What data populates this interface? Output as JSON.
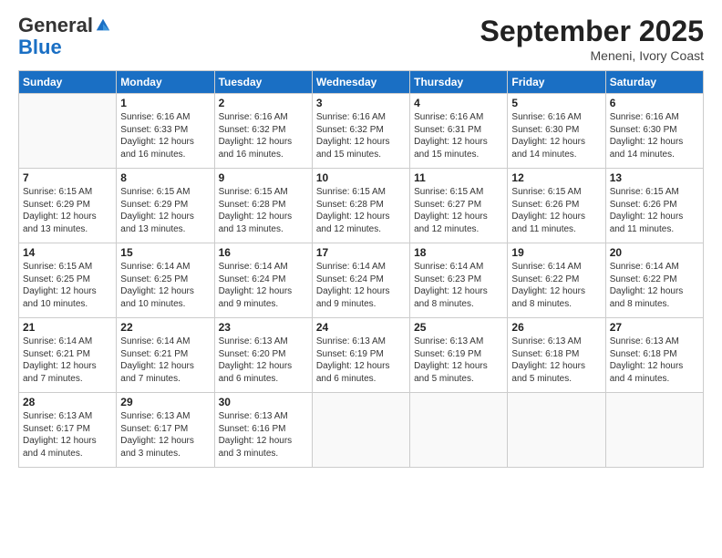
{
  "logo": {
    "general": "General",
    "blue": "Blue"
  },
  "title": "September 2025",
  "location": "Meneni, Ivory Coast",
  "days_header": [
    "Sunday",
    "Monday",
    "Tuesday",
    "Wednesday",
    "Thursday",
    "Friday",
    "Saturday"
  ],
  "weeks": [
    [
      {
        "day": "",
        "info": ""
      },
      {
        "day": "1",
        "info": "Sunrise: 6:16 AM\nSunset: 6:33 PM\nDaylight: 12 hours\nand 16 minutes."
      },
      {
        "day": "2",
        "info": "Sunrise: 6:16 AM\nSunset: 6:32 PM\nDaylight: 12 hours\nand 16 minutes."
      },
      {
        "day": "3",
        "info": "Sunrise: 6:16 AM\nSunset: 6:32 PM\nDaylight: 12 hours\nand 15 minutes."
      },
      {
        "day": "4",
        "info": "Sunrise: 6:16 AM\nSunset: 6:31 PM\nDaylight: 12 hours\nand 15 minutes."
      },
      {
        "day": "5",
        "info": "Sunrise: 6:16 AM\nSunset: 6:30 PM\nDaylight: 12 hours\nand 14 minutes."
      },
      {
        "day": "6",
        "info": "Sunrise: 6:16 AM\nSunset: 6:30 PM\nDaylight: 12 hours\nand 14 minutes."
      }
    ],
    [
      {
        "day": "7",
        "info": "Sunrise: 6:15 AM\nSunset: 6:29 PM\nDaylight: 12 hours\nand 13 minutes."
      },
      {
        "day": "8",
        "info": "Sunrise: 6:15 AM\nSunset: 6:29 PM\nDaylight: 12 hours\nand 13 minutes."
      },
      {
        "day": "9",
        "info": "Sunrise: 6:15 AM\nSunset: 6:28 PM\nDaylight: 12 hours\nand 13 minutes."
      },
      {
        "day": "10",
        "info": "Sunrise: 6:15 AM\nSunset: 6:28 PM\nDaylight: 12 hours\nand 12 minutes."
      },
      {
        "day": "11",
        "info": "Sunrise: 6:15 AM\nSunset: 6:27 PM\nDaylight: 12 hours\nand 12 minutes."
      },
      {
        "day": "12",
        "info": "Sunrise: 6:15 AM\nSunset: 6:26 PM\nDaylight: 12 hours\nand 11 minutes."
      },
      {
        "day": "13",
        "info": "Sunrise: 6:15 AM\nSunset: 6:26 PM\nDaylight: 12 hours\nand 11 minutes."
      }
    ],
    [
      {
        "day": "14",
        "info": "Sunrise: 6:15 AM\nSunset: 6:25 PM\nDaylight: 12 hours\nand 10 minutes."
      },
      {
        "day": "15",
        "info": "Sunrise: 6:14 AM\nSunset: 6:25 PM\nDaylight: 12 hours\nand 10 minutes."
      },
      {
        "day": "16",
        "info": "Sunrise: 6:14 AM\nSunset: 6:24 PM\nDaylight: 12 hours\nand 9 minutes."
      },
      {
        "day": "17",
        "info": "Sunrise: 6:14 AM\nSunset: 6:24 PM\nDaylight: 12 hours\nand 9 minutes."
      },
      {
        "day": "18",
        "info": "Sunrise: 6:14 AM\nSunset: 6:23 PM\nDaylight: 12 hours\nand 8 minutes."
      },
      {
        "day": "19",
        "info": "Sunrise: 6:14 AM\nSunset: 6:22 PM\nDaylight: 12 hours\nand 8 minutes."
      },
      {
        "day": "20",
        "info": "Sunrise: 6:14 AM\nSunset: 6:22 PM\nDaylight: 12 hours\nand 8 minutes."
      }
    ],
    [
      {
        "day": "21",
        "info": "Sunrise: 6:14 AM\nSunset: 6:21 PM\nDaylight: 12 hours\nand 7 minutes."
      },
      {
        "day": "22",
        "info": "Sunrise: 6:14 AM\nSunset: 6:21 PM\nDaylight: 12 hours\nand 7 minutes."
      },
      {
        "day": "23",
        "info": "Sunrise: 6:13 AM\nSunset: 6:20 PM\nDaylight: 12 hours\nand 6 minutes."
      },
      {
        "day": "24",
        "info": "Sunrise: 6:13 AM\nSunset: 6:19 PM\nDaylight: 12 hours\nand 6 minutes."
      },
      {
        "day": "25",
        "info": "Sunrise: 6:13 AM\nSunset: 6:19 PM\nDaylight: 12 hours\nand 5 minutes."
      },
      {
        "day": "26",
        "info": "Sunrise: 6:13 AM\nSunset: 6:18 PM\nDaylight: 12 hours\nand 5 minutes."
      },
      {
        "day": "27",
        "info": "Sunrise: 6:13 AM\nSunset: 6:18 PM\nDaylight: 12 hours\nand 4 minutes."
      }
    ],
    [
      {
        "day": "28",
        "info": "Sunrise: 6:13 AM\nSunset: 6:17 PM\nDaylight: 12 hours\nand 4 minutes."
      },
      {
        "day": "29",
        "info": "Sunrise: 6:13 AM\nSunset: 6:17 PM\nDaylight: 12 hours\nand 3 minutes."
      },
      {
        "day": "30",
        "info": "Sunrise: 6:13 AM\nSunset: 6:16 PM\nDaylight: 12 hours\nand 3 minutes."
      },
      {
        "day": "",
        "info": ""
      },
      {
        "day": "",
        "info": ""
      },
      {
        "day": "",
        "info": ""
      },
      {
        "day": "",
        "info": ""
      }
    ]
  ]
}
